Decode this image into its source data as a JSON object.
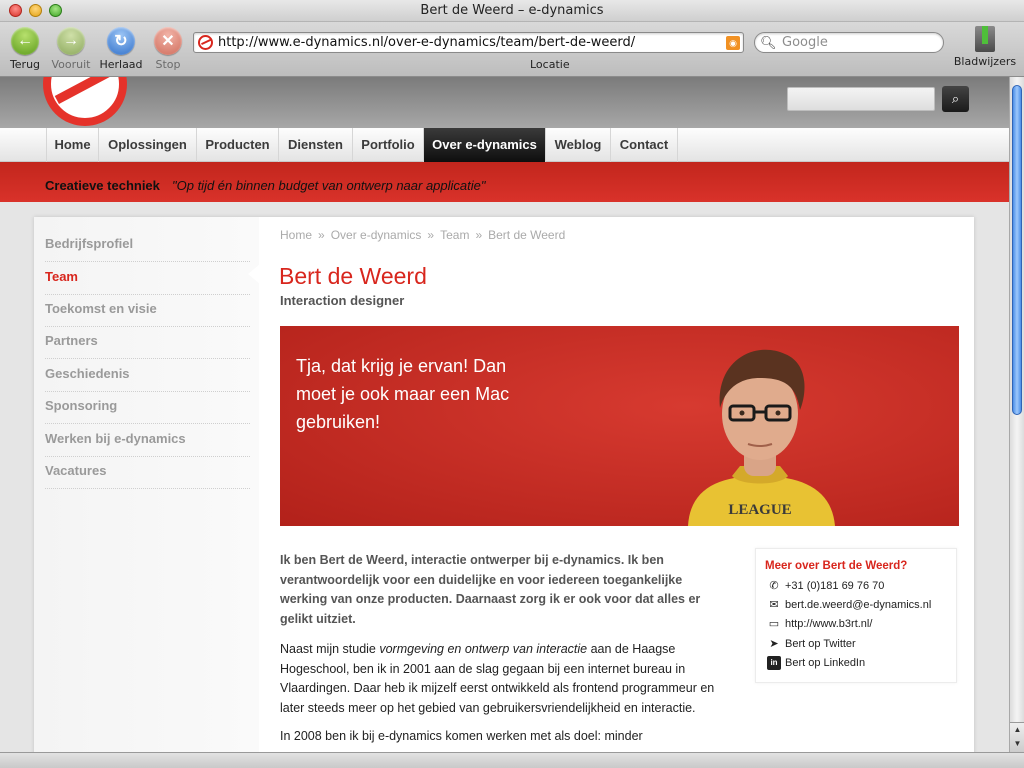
{
  "window": {
    "title": "Bert de Weerd – e-dynamics"
  },
  "toolbar": {
    "back": "Terug",
    "forward": "Vooruit",
    "reload": "Herlaad",
    "stop": "Stop",
    "url": "http://www.e-dynamics.nl/over-e-dynamics/team/bert-de-weerd/",
    "url_label": "Locatie",
    "search_placeholder": "Google",
    "bookmarks": "Bladwijzers"
  },
  "nav": {
    "items": [
      "Home",
      "Oplossingen",
      "Producten",
      "Diensten",
      "Portfolio",
      "Over e-dynamics",
      "Weblog",
      "Contact"
    ],
    "active": "Over e-dynamics"
  },
  "tagline": {
    "strong": "Creatieve techniek",
    "quote": "\"Op tijd én binnen budget van ontwerp naar applicatie\""
  },
  "sidebar": {
    "items": [
      "Bedrijfsprofiel",
      "Team",
      "Toekomst en visie",
      "Partners",
      "Geschiedenis",
      "Sponsoring",
      "Werken bij e-dynamics",
      "Vacatures"
    ],
    "active": "Team"
  },
  "breadcrumb": [
    "Home",
    "»",
    "Over e-dynamics",
    "»",
    "Team",
    "»",
    "Bert de Weerd"
  ],
  "profile": {
    "name": "Bert de Weerd",
    "role": "Interaction designer",
    "hero_quote": "Tja, dat krijg je ervan! Dan moet je ook maar een Mac gebruiken!",
    "shirt_text": "LEAGUE"
  },
  "content": {
    "intro": "Ik ben Bert de Weerd, interactie ontwerper bij e-dynamics. Ik ben verantwoordelijk voor een duidelijke en voor iedereen toegankelijke werking van onze producten. Daarnaast zorg ik er ook voor dat alles er gelikt uitziet.",
    "p1_a": "Naast mijn studie ",
    "p1_em": "vormgeving en ontwerp van interactie",
    "p1_b": " aan de Haagse Hogeschool, ben ik in 2001 aan de slag gegaan bij een internet bureau in Vlaardingen. Daar heb ik mijzelf eerst ontwikkeld als frontend programmeur en later steeds meer op het gebied van gebruikersvriendelijkheid en interactie.",
    "p2": "In 2008 ben ik bij e-dynamics komen werken met als doel: minder"
  },
  "more": {
    "title": "Meer over Bert de Weerd?",
    "phone": "+31 (0)181 69 76 70",
    "email": "bert.de.weerd@e-dynamics.nl",
    "website": "http://www.b3rt.nl/",
    "twitter": "Bert op Twitter",
    "linkedin": "Bert op LinkedIn"
  },
  "colors": {
    "brand_red": "#d8261d",
    "nav_active": "#111111"
  },
  "icons": [
    "back-arrow-icon",
    "forward-arrow-icon",
    "reload-icon",
    "stop-icon",
    "rss-icon",
    "search-icon",
    "bookmarks-icon",
    "phone-icon",
    "mail-icon",
    "monitor-icon",
    "twitter-bird-icon",
    "linkedin-icon"
  ]
}
